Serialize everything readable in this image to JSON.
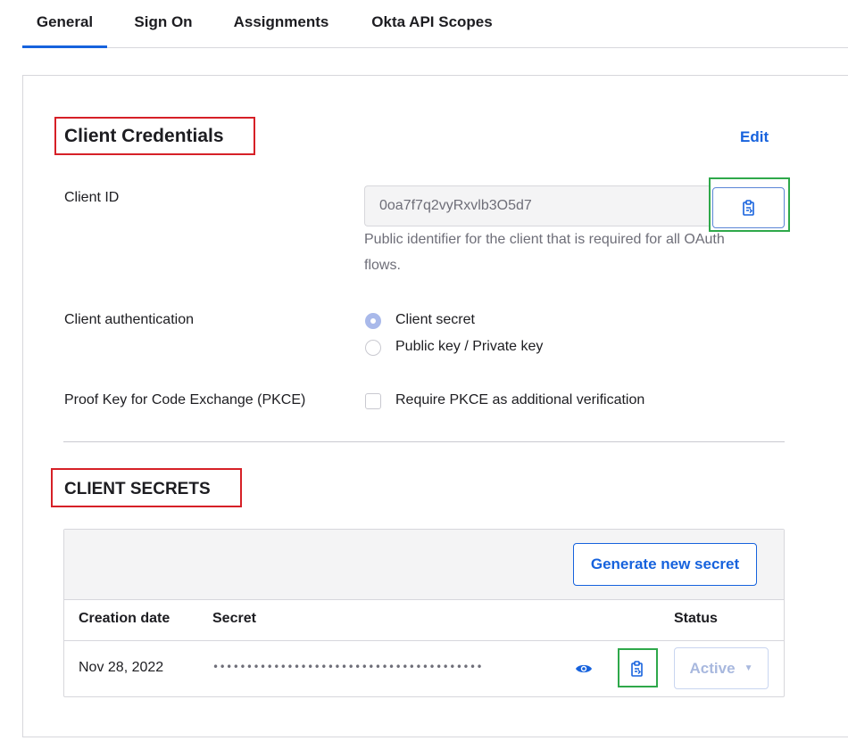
{
  "tabs": [
    {
      "label": "General",
      "active": true
    },
    {
      "label": "Sign On",
      "active": false
    },
    {
      "label": "Assignments",
      "active": false
    },
    {
      "label": "Okta API Scopes",
      "active": false
    }
  ],
  "credentials": {
    "title": "Client Credentials",
    "edit_label": "Edit",
    "client_id": {
      "label": "Client ID",
      "value": "0oa7f7q2vyRxvlb3O5d7",
      "hint_line1": "Public identifier for the client that is required for all OAuth",
      "hint_line2": "flows.",
      "copy_icon": "clipboard-icon"
    },
    "authentication": {
      "label": "Client authentication",
      "options": [
        {
          "label": "Client secret",
          "selected": true
        },
        {
          "label": "Public key / Private key",
          "selected": false
        }
      ]
    },
    "pkce": {
      "label": "Proof Key for Code Exchange (PKCE)",
      "checkbox_label": "Require PKCE as additional verification",
      "checked": false
    }
  },
  "secrets": {
    "title": "CLIENT SECRETS",
    "generate_label": "Generate new secret",
    "columns": [
      "Creation date",
      "Secret",
      "Status"
    ],
    "rows": [
      {
        "creation_date": "Nov 28, 2022",
        "secret": "••••••••••••••••••••••••••••••••••••••••",
        "status": "Active",
        "reveal_icon": "eye-icon",
        "copy_icon": "clipboard-icon"
      }
    ]
  },
  "colors": {
    "accent": "#1662dd",
    "highlight_red": "#d62027",
    "highlight_green": "#2ea84a",
    "muted_text": "#6e6e78"
  }
}
